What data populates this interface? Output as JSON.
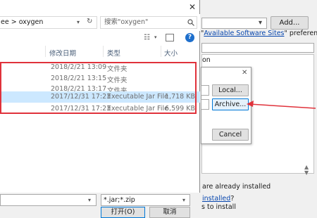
{
  "eclipse": {
    "add_label": "Add...",
    "avail_prefix": "\"",
    "avail_link": "Available Software Sites",
    "avail_suffix": "\" preferences.",
    "on_text": "on",
    "already_installed": "are already installed",
    "installed_link": "installed",
    "installed_suffix": "?",
    "hint_text": "s to install"
  },
  "repo_dialog": {
    "local_label": "Local...",
    "archive_label": "Archive...",
    "cancel_label": "Cancel"
  },
  "file_dialog": {
    "path_text": "ee  >  oxygen",
    "search_placeholder": "搜索\"oxygen\"",
    "help_label": "?",
    "columns": {
      "date": "修改日期",
      "type": "类型",
      "size": "大小"
    },
    "rows": [
      {
        "date": "2018/2/21 13:09",
        "type": "文件夹",
        "size": ""
      },
      {
        "date": "2018/2/21 13:15",
        "type": "文件夹",
        "size": ""
      },
      {
        "date": "2018/2/21 13:17",
        "type": "文件夹",
        "size": ""
      },
      {
        "date": "2017/12/31 17:23",
        "type": "Executable Jar File",
        "size": "1,718 KB"
      },
      {
        "date": "2017/12/31 17:23",
        "type": "Executable Jar File",
        "size": "6,599 KB"
      }
    ],
    "filter_value": "*.jar;*.zip",
    "open_label": "打开(O)",
    "cancel_label": "取消"
  },
  "colors": {
    "highlight_red": "#e0323b",
    "selection": "#cce8ff",
    "link": "#0645ad"
  }
}
